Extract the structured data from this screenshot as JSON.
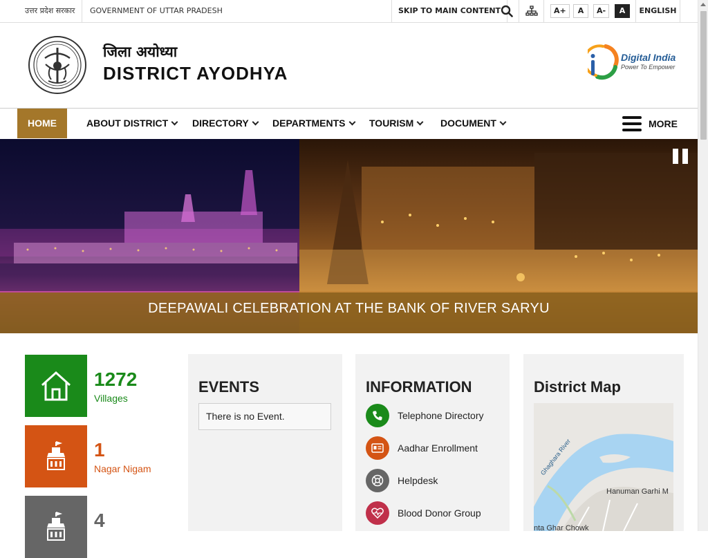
{
  "topbar": {
    "gov_hindi": "उत्तर प्रदेश सरकार",
    "gov_english": "GOVERNMENT OF UTTAR PRADESH",
    "skip_link": "SKIP TO MAIN CONTENT",
    "font_buttons": [
      "A+",
      "A",
      "A-",
      "A"
    ],
    "language": "ENGLISH"
  },
  "header": {
    "title_hindi": "जिला अयोध्या",
    "title_english": "DISTRICT AYODHYA",
    "digital_india_title": "Digital India",
    "digital_india_tagline": "Power To Empower"
  },
  "nav": {
    "items": [
      {
        "label": "HOME",
        "active": true
      },
      {
        "label": "ABOUT DISTRICT"
      },
      {
        "label": "DIRECTORY"
      },
      {
        "label": "DEPARTMENTS"
      },
      {
        "label": "TOURISM"
      },
      {
        "label": "DOCUMENT"
      }
    ],
    "more_label": "MORE"
  },
  "banner": {
    "caption": "DEEPAWALI CELEBRATION AT THE BANK OF RIVER SARYU"
  },
  "stats": [
    {
      "value": "1272",
      "label": "Villages",
      "color": "#1a8a1a",
      "icon": "home-icon"
    },
    {
      "value": "1",
      "label": "Nagar Nigam",
      "color": "#d45414",
      "icon": "temple-icon"
    },
    {
      "value": "4",
      "label": "",
      "color": "#666666",
      "icon": "temple-icon"
    }
  ],
  "events": {
    "title": "EVENTS",
    "empty_message": "There is no Event."
  },
  "information": {
    "title": "INFORMATION",
    "items": [
      {
        "label": "Telephone Directory",
        "color": "#1a8a1a",
        "icon": "phone-icon"
      },
      {
        "label": "Aadhar Enrollment",
        "color": "#d45414",
        "icon": "id-card-icon"
      },
      {
        "label": "Helpdesk",
        "color": "#666666",
        "icon": "helpdesk-icon"
      },
      {
        "label": "Blood Donor Group",
        "color": "#c0304a",
        "icon": "heart-icon"
      }
    ]
  },
  "district_map": {
    "title": "District Map",
    "river_label": "Ghaghara River",
    "place_label": "Hanuman Garhi M",
    "place_label_2": "nta Ghar Chowk"
  },
  "colors": {
    "accent": "#a4772a",
    "caption_bar": "#8c621e"
  }
}
